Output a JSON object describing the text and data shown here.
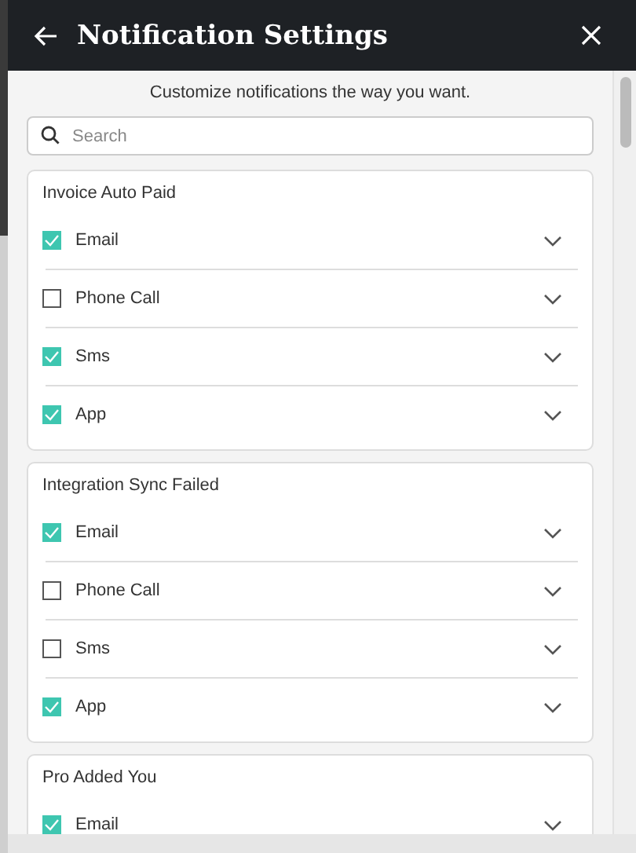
{
  "header": {
    "title": "Notification Settings"
  },
  "subtitle": "Customize notifications the way you want.",
  "search": {
    "placeholder": "Search"
  },
  "groups": [
    {
      "title": "Invoice Auto Paid",
      "channels": [
        {
          "label": "Email",
          "checked": true
        },
        {
          "label": "Phone Call",
          "checked": false
        },
        {
          "label": "Sms",
          "checked": true
        },
        {
          "label": "App",
          "checked": true
        }
      ]
    },
    {
      "title": "Integration Sync Failed",
      "channels": [
        {
          "label": "Email",
          "checked": true
        },
        {
          "label": "Phone Call",
          "checked": false
        },
        {
          "label": "Sms",
          "checked": false
        },
        {
          "label": "App",
          "checked": true
        }
      ]
    },
    {
      "title": "Pro Added You",
      "channels": [
        {
          "label": "Email",
          "checked": true
        }
      ]
    }
  ]
}
